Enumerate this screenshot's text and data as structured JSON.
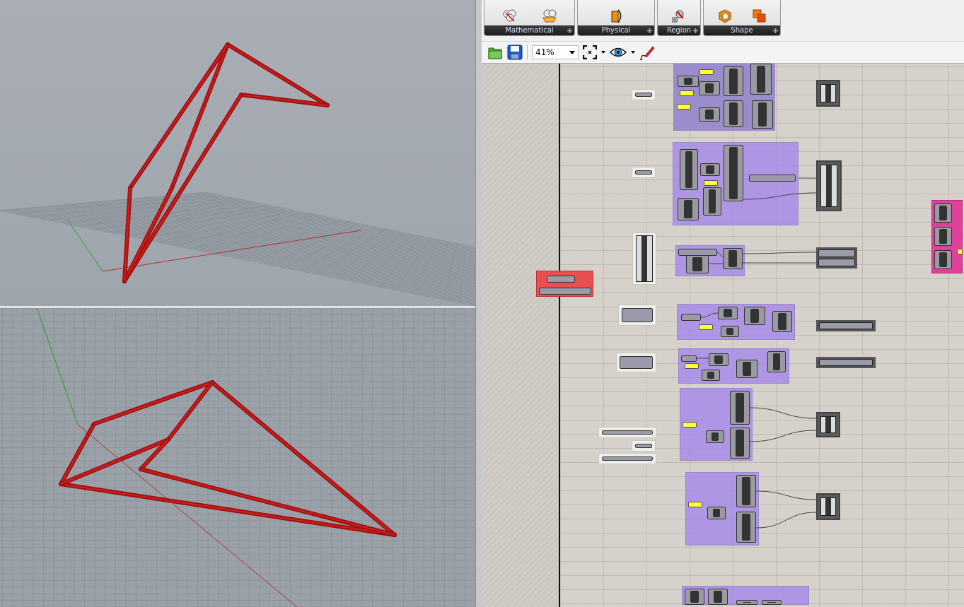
{
  "ribbon": {
    "panels": [
      {
        "label": "Mathematical"
      },
      {
        "label": "Physical"
      },
      {
        "label": "Region"
      },
      {
        "label": "Shape"
      }
    ]
  },
  "toolbar": {
    "zoom": "41%"
  }
}
